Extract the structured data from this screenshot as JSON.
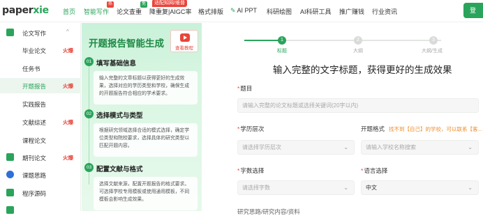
{
  "brand": {
    "logo_main": "paper",
    "logo_accent": "xie"
  },
  "topnav": {
    "items": [
      {
        "label": "首页",
        "active": true
      },
      {
        "label": "智能写作",
        "tag": "热"
      },
      {
        "label": "论文查重",
        "tag": "免"
      },
      {
        "label": "降重复|AIGC率"
      },
      {
        "label": "格式排版"
      },
      {
        "label": "AI PPT"
      },
      {
        "label": "科研绘图"
      },
      {
        "label": "AI科研工具"
      },
      {
        "label": "推广赚钱"
      },
      {
        "label": "行业资讯"
      }
    ],
    "promo": "适配知网/维普",
    "user_button": "登"
  },
  "sidebar": {
    "items": [
      {
        "label": "论文写作",
        "type": "parent",
        "caret": "^"
      },
      {
        "label": "毕业论文",
        "type": "child",
        "hot": "火爆"
      },
      {
        "label": "任务书",
        "type": "child"
      },
      {
        "label": "开题报告",
        "type": "child",
        "hot": "火爆",
        "selected": true
      },
      {
        "label": "实践报告",
        "type": "child"
      },
      {
        "label": "文献综述",
        "type": "child",
        "hot": "火爆"
      },
      {
        "label": "课程论文",
        "type": "child"
      },
      {
        "label": "期刊论文",
        "type": "parent",
        "hot": "火爆"
      },
      {
        "label": "课题思路",
        "type": "parent"
      },
      {
        "label": "程序源码",
        "type": "parent"
      }
    ]
  },
  "guide": {
    "title": "开题报告智能生成",
    "video_label": "查看教程",
    "steps": [
      {
        "num": "01",
        "title": "填写基础信息",
        "body": "输入完整的文章标题以获得更好的生成效果，选择对应的学历类型和学校，确保生成的开题报告符合相应的学术要求。"
      },
      {
        "num": "02",
        "title": "选择模式与类型",
        "body": "根据研究领域选择合适的模式选择，确定学位类型和院校要求，选择具体的研究类型以匹配开题内容。"
      },
      {
        "num": "03",
        "title": "配置文献与格式",
        "body": "选择文献来源，配置开题报告的格式要求。可选择学校专用模板或使用通用模板，不同模板会影响生成效果。"
      }
    ]
  },
  "progress": {
    "steps": [
      {
        "num": "1",
        "label": "标题",
        "active": true
      },
      {
        "num": "2",
        "label": "大纲",
        "active": false
      },
      {
        "num": "3",
        "label": "大纲/生成",
        "active": false
      }
    ]
  },
  "form": {
    "heading": "输入完整的文字标题，获得更好的生成效果",
    "title_label": "题目",
    "title_placeholder": "请输入完整的论文标题或选择关键词(20字以内)",
    "degree_label": "学历层次",
    "degree_placeholder": "请选择学历层次",
    "format_label": "开题格式",
    "format_hint": "找不到【自己】的学校，可以联系【客...",
    "format_placeholder": "请输入学校名称搜索",
    "words_label": "字数选择",
    "words_placeholder": "请选择字数",
    "language_label": "语言选择",
    "language_value": "中文",
    "next_label": "研究思路/研究内容/资料"
  },
  "colors": {
    "brand_green": "#2aa45b",
    "hot_red": "#e9443a",
    "hint_orange": "#f08c2a"
  }
}
